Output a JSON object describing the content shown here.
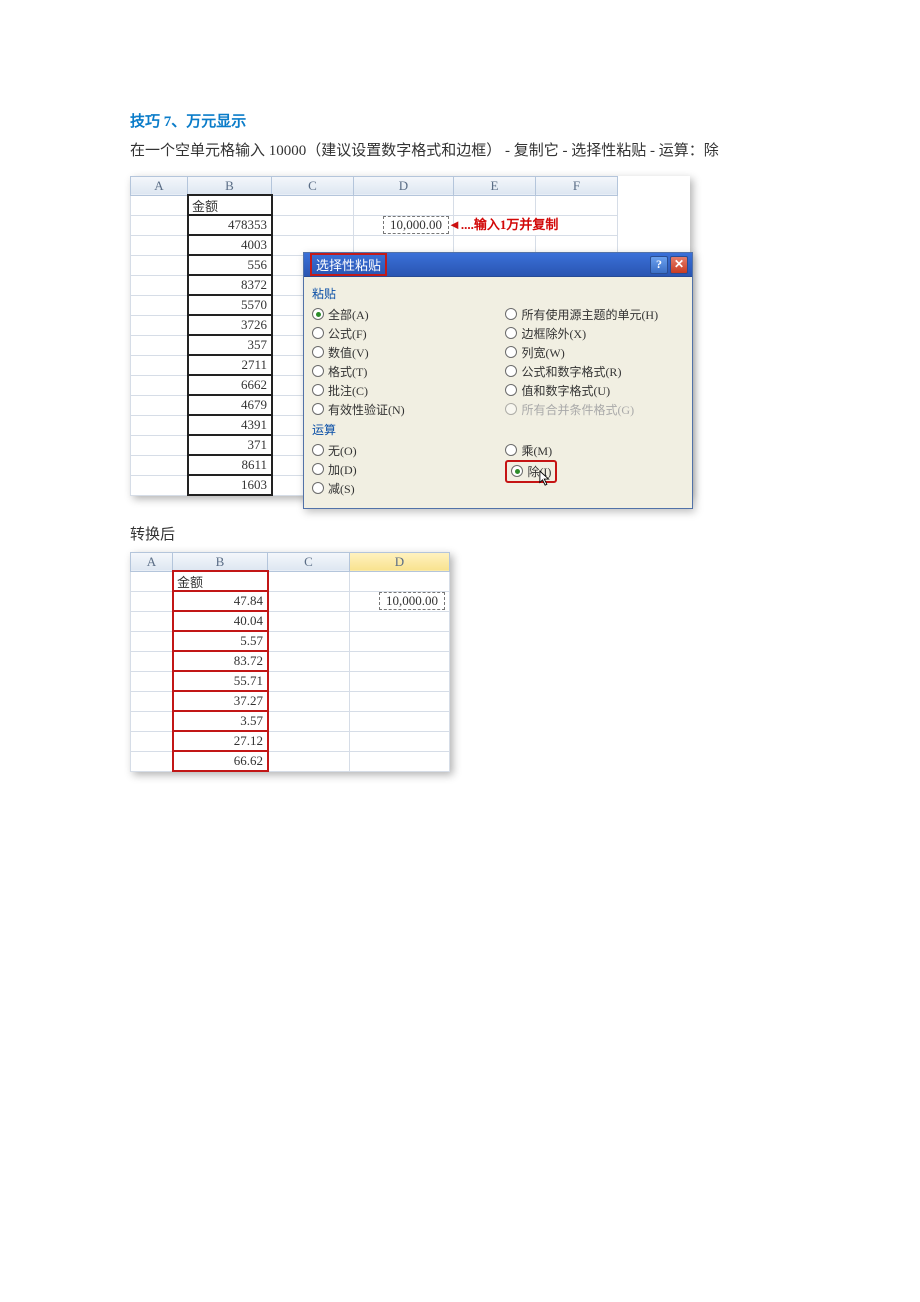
{
  "tip": {
    "title": "技巧 7、万元显示"
  },
  "body": {
    "p1": "在一个空单元格输入 10000（建议设置数字格式和边框）  -  复制它  -  选择性粘贴  -  运算：除",
    "after": "转换后"
  },
  "sheet1": {
    "headers": [
      "A",
      "B",
      "C",
      "D",
      "E",
      "F"
    ],
    "col_b_label": "金额",
    "col_b_values": [
      "478353",
      "4003",
      "556",
      "8372",
      "5570",
      "3726",
      "357",
      "2711",
      "6662",
      "4679",
      "4391",
      "371",
      "8611",
      "1603"
    ],
    "d_value": "10,000.00",
    "annot": "输入1万并复制",
    "annot_prefix": "...."
  },
  "dialog": {
    "title": "选择性粘贴",
    "group_paste": "粘贴",
    "paste_left": [
      "全部(A)",
      "公式(F)",
      "数值(V)",
      "格式(T)",
      "批注(C)",
      "有效性验证(N)"
    ],
    "paste_right": [
      "所有使用源主题的单元(H)",
      "边框除外(X)",
      "列宽(W)",
      "公式和数字格式(R)",
      "值和数字格式(U)",
      "所有合并条件格式(G)"
    ],
    "group_op": "运算",
    "op_left": [
      "无(O)",
      "加(D)",
      "减(S)"
    ],
    "op_right": [
      "乘(M)",
      "除(I)"
    ],
    "selected_paste": 0,
    "selected_op_right": 1
  },
  "sheet2": {
    "headers": [
      "A",
      "B",
      "C",
      "D"
    ],
    "col_b_label": "金额",
    "col_b_values": [
      "47.84",
      "40.04",
      "5.57",
      "83.72",
      "55.71",
      "37.27",
      "3.57",
      "27.12",
      "66.62"
    ],
    "d_value": "10,000.00"
  }
}
